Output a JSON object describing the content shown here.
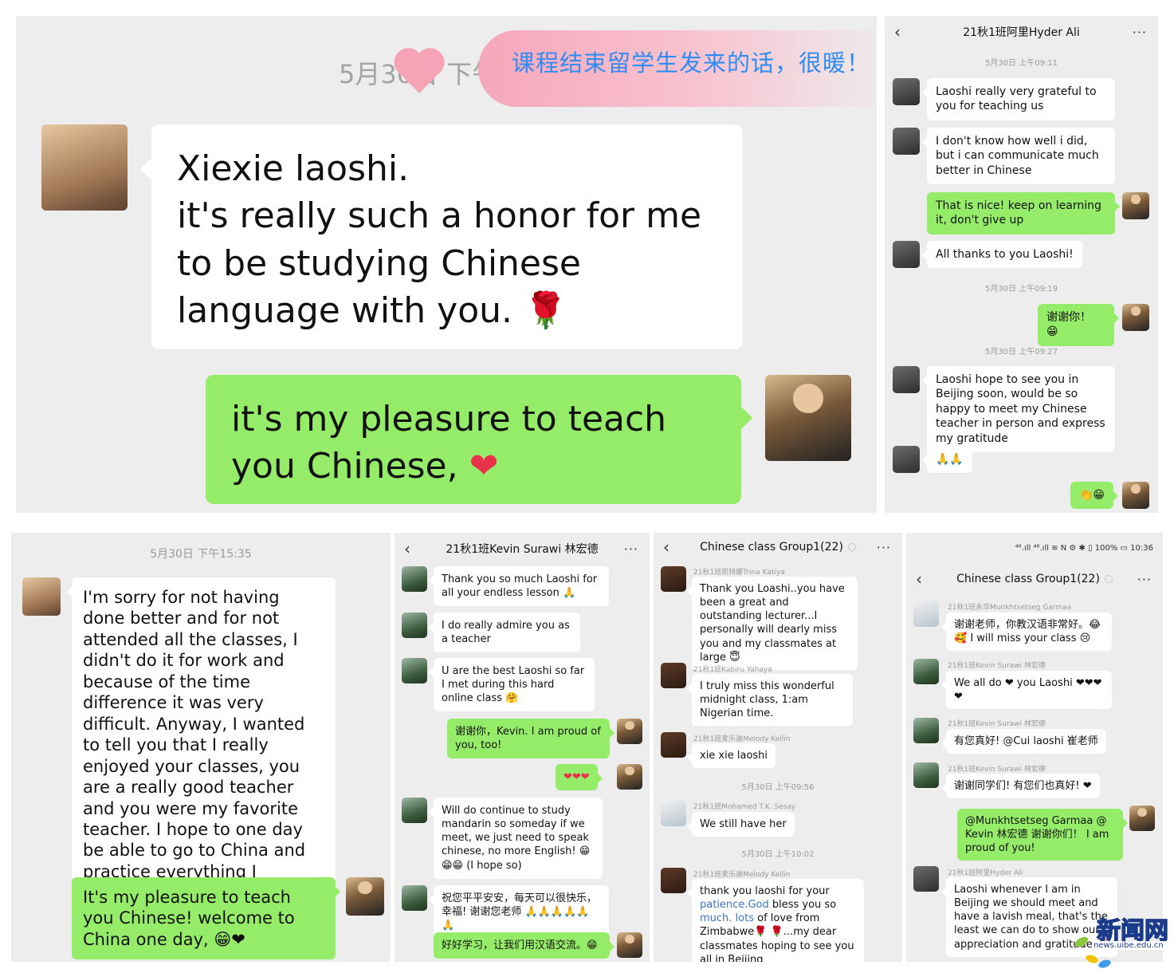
{
  "p1": {
    "time": "5月30日 下午14:25",
    "banner": "课程结束留学生发来的话，很暖！",
    "student_msg_line1": "Xiexie laoshi.",
    "student_msg_line2": "it's really such a honor for me to be studying Chinese language with you.",
    "student_emoji": "🌹",
    "teacher_msg": "it's my pleasure to teach you Chinese,",
    "teacher_emoji": "❤"
  },
  "p2": {
    "title": "21秋1班阿里Hyder Ali",
    "time1": "5月30日 上午09:11",
    "m1": "Laoshi really very grateful to you for teaching us",
    "m2": "I don't know how well i did, but i can communicate much better in Chinese",
    "m3": "That is nice! keep on learning it, don't give up",
    "m4": "All thanks to you Laoshi!",
    "time2": "5月30日 上午09:19",
    "m5": "谢谢你！ 😁",
    "time3": "5月30日 上午09:27",
    "m6": "Laoshi hope to see you in Beijing soon, would be so happy to meet my Chinese teacher in person and express my gratitude",
    "m7": "🙏🙏",
    "m8": "👏😁"
  },
  "p3": {
    "time": "5月30日 下午15:35",
    "student_msg": "I'm sorry for not having done better and for not attended all the classes, I didn't do it for work and because of the time difference it was very difficult. Anyway, I wanted to tell you that I really enjoyed your classes, you are a really good teacher and you were my favorite teacher.  I hope to one day be able to go to China and practice everything I learned in your course。谢谢老师 from my",
    "student_emoji": "❤",
    "teacher_msg": "It's my pleasure to teach you Chinese! welcome to China one day,",
    "teacher_emoji": "😁❤"
  },
  "p4": {
    "title": "21秋1班Kevin Surawi 林宏德",
    "m1": "Thank you so much Laoshi for all your endless lesson 🙏",
    "m2": "I do really admire you as a teacher",
    "m3": "U are the best Laoshi so far I met during this hard online class 🤗",
    "m4": "谢谢你，Kevin. I am proud of you, too!",
    "m5": "❤❤❤",
    "m6": "Will do continue to study mandarin so someday if we meet, we just need to speak chinese, no more English! 😁😁😁 (I hope so)",
    "m7": "祝您平平安安，每天可以很快乐，幸福! 谢谢您老师 🙏🙏🙏🙏🙏🙏",
    "m8": "好好学习，让我们用汉语交流。😁"
  },
  "p5": {
    "title": "Chinese class Group1(22)",
    "s1": "21秋1班凯特娜Trina Katiya",
    "m1": "Thank you Loashi..you have been a great and outstanding lecturer...I personally will dearly miss you and my classmates at large 😇",
    "s2": "21秋1班Kabiru Yahaya",
    "m2": "I truly miss this wonderful midnight class, 1:am Nigerian time.",
    "s3": "21秋1班麦乐迪Melody Kellin",
    "m3": "xie xie laoshi",
    "time1": "5月30日 上午09:56",
    "s4": "21秋1班Mohamed T.K. Sesay",
    "m4": "We still have her",
    "time2": "5月30日 上午10:02",
    "s5": "21秋1班麦乐迪Melody Kellin",
    "m5a": "thank you laoshi for your",
    "m5b": "patience.God",
    "m5c": " bless you so ",
    "m5d": "much.",
    "m5e": "lots",
    "m5f": " of love from Zimbabwe🌹",
    "m5g": "🌹...my dear classmates hoping to see you all in Beijing"
  },
  "p6": {
    "status": "⁴⁶.ıll ⁴⁶.ıll ≋  N ⚙ ✱ ▯ 100% ▭ 10:36",
    "title": "Chinese class Group1(22)",
    "s1": "21秋1班永华Munkhtsetseg Garmaa",
    "m1": "谢谢老师，你教汉语非常好。😂 🥰 I will miss your class 😢",
    "s2": "21秋1班Kevin Surawi 林宏德",
    "m2": "We all do ❤ you Laoshi ❤❤❤ ❤",
    "s3": "21秋1班Kevin Surawi 林宏德",
    "m3": "有您真好! @Cui laoshi 崔老师",
    "s4": "21秋1班Kevin Surawi 林宏德",
    "m4": "谢谢同学们! 有您们也真好! ❤",
    "m5": "@Munkhtsetseg Garmaa @ Kevin 林宏德  谢谢你们！ I am proud of you!",
    "s6": "21秋1班阿里Hyder Ali",
    "m6": "Laoshi whenever I am in Beijing we should meet and have a lavish meal, that's the least we can do to show our appreciation and gratitude 🥳"
  },
  "watermark": {
    "text": "新闻网",
    "url": "news.uibe.edu.cn"
  }
}
